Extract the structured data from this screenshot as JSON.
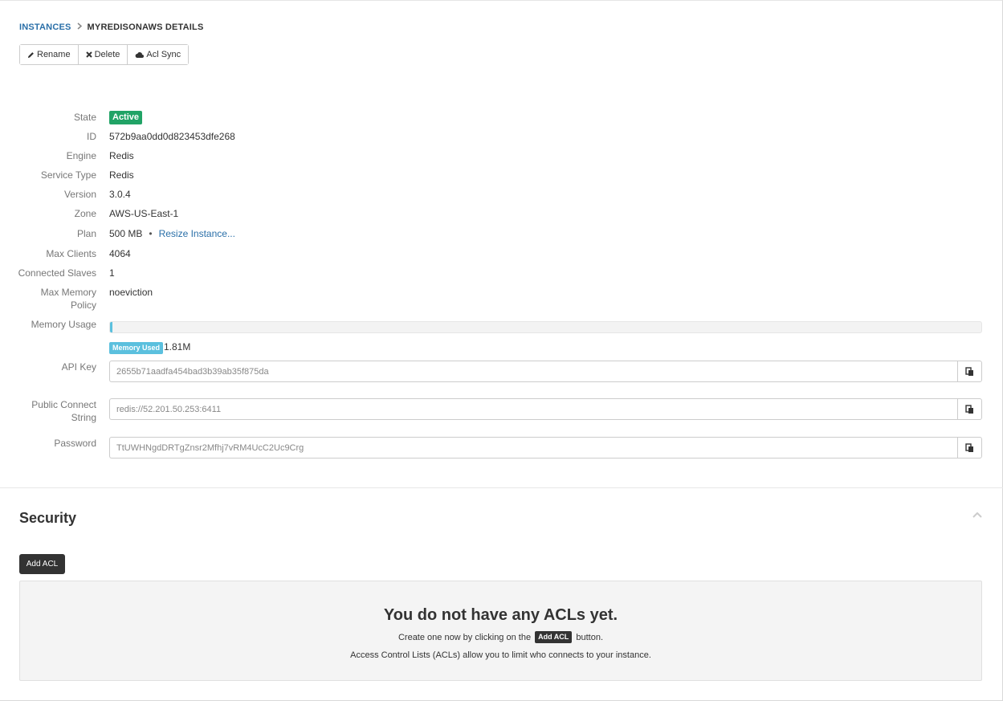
{
  "breadcrumb": {
    "parent": "INSTANCES",
    "current": "MYREDISONAWS DETAILS"
  },
  "toolbar": {
    "rename": "Rename",
    "delete": "Delete",
    "acl_sync": "Acl Sync"
  },
  "details": {
    "state": {
      "label": "State",
      "value": "Active",
      "color": "#21a366"
    },
    "id": {
      "label": "ID",
      "value": "572b9aa0dd0d823453dfe268"
    },
    "engine": {
      "label": "Engine",
      "value": "Redis"
    },
    "service_type": {
      "label": "Service Type",
      "value": "Redis"
    },
    "version": {
      "label": "Version",
      "value": "3.0.4"
    },
    "zone": {
      "label": "Zone",
      "value": "AWS-US-East-1"
    },
    "plan": {
      "label": "Plan",
      "value": "500 MB",
      "separator": "•",
      "resize_link": "Resize Instance..."
    },
    "max_clients": {
      "label": "Max Clients",
      "value": "4064"
    },
    "connected_slaves": {
      "label": "Connected Slaves",
      "value": "1"
    },
    "max_memory_policy": {
      "label_line1": "Max Memory",
      "label_line2": "Policy",
      "value": "noeviction"
    },
    "memory_usage": {
      "label": "Memory Usage",
      "fraction_used": 0.002,
      "badge": "Memory Used",
      "value": "1.81M",
      "color": "#5bc0de"
    }
  },
  "credentials": {
    "api_key": {
      "label": "API Key",
      "value": "2655b71aadfa454bad3b39ab35f875da"
    },
    "public_connect_string": {
      "label_line1": "Public Connect",
      "label_line2": "String",
      "value": "redis://52.201.50.253:6411"
    },
    "password": {
      "label": "Password",
      "value": "TtUWHNgdDRTgZnsr2Mfhj7vRM4UcC2Uc9Crg"
    }
  },
  "security": {
    "title": "Security",
    "add_acl": "Add ACL",
    "empty_title": "You do not have any ACLs yet.",
    "empty_line1_prefix": "Create one now by clicking on the",
    "empty_line1_badge": "Add ACL",
    "empty_line1_suffix": "button.",
    "empty_line2": "Access Control Lists (ACLs) allow you to limit who connects to your instance."
  }
}
